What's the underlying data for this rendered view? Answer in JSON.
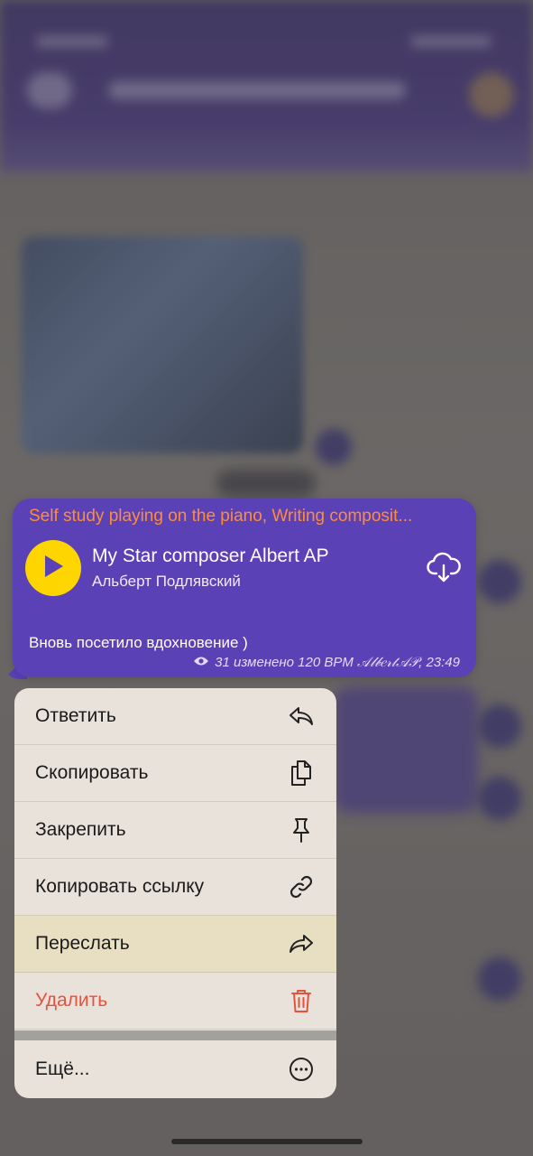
{
  "colors": {
    "bubble": "#5b41b6",
    "header_text": "#ff8c3a",
    "play_button": "#ffd500",
    "menu_bg": "#ece6de",
    "menu_highlight": "#e8dec2",
    "danger": "#e5533f"
  },
  "message": {
    "header": "Self study playing on the piano, Writing composit...",
    "track_title": "My Star composer Albert AP",
    "track_artist": "Альберт Подлявский",
    "text": "Вновь посетило вдохновение )",
    "meta": "31 изменено 120 BPM 𝒜𝓁𝒷𝑒𝓇𝓉𝒜𝒫, 23:49",
    "play_icon": "play-icon",
    "download_icon": "cloud-download-icon",
    "views_icon": "eye-icon"
  },
  "menu": {
    "items": [
      {
        "label": "Ответить",
        "icon": "reply-icon"
      },
      {
        "label": "Скопировать",
        "icon": "copy-icon"
      },
      {
        "label": "Закрепить",
        "icon": "pin-icon"
      },
      {
        "label": "Копировать ссылку",
        "icon": "link-icon"
      },
      {
        "label": "Переслать",
        "icon": "forward-icon"
      },
      {
        "label": "Удалить",
        "icon": "trash-icon"
      },
      {
        "label": "Ещё...",
        "icon": "more-icon"
      }
    ]
  }
}
